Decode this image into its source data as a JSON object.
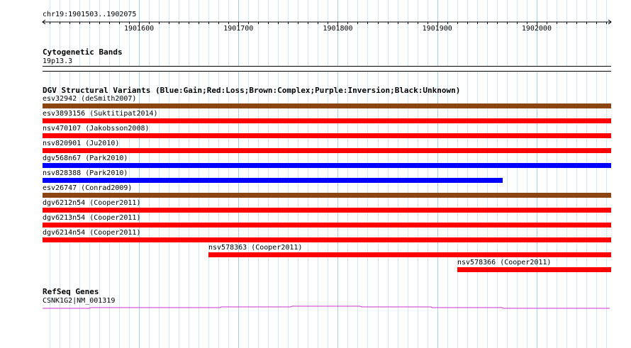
{
  "ruler": {
    "location": "chr19:1901503..1902075",
    "ticks": [
      "1901600",
      "1901700",
      "1901800",
      "1901900",
      "1902000"
    ]
  },
  "cytoband": {
    "title": "Cytogenetic Bands",
    "band": "19p13.3"
  },
  "dgv": {
    "title": "DGV Structural Variants (Blue:Gain;Red:Loss;Brown:Complex;Purple:Inversion;Black:Unknown)",
    "colors": {
      "gain": "#0000ff",
      "loss": "#ff0000",
      "complex": "#8b4513",
      "inversion": "#800080",
      "unknown": "#000000"
    },
    "variants": [
      {
        "label": "esv32942 (deSmith2007)",
        "type": "complex",
        "start": 1901503,
        "end": 1902075
      },
      {
        "label": "esv3893156 (Suktitipat2014)",
        "type": "loss",
        "start": 1901503,
        "end": 1902075
      },
      {
        "label": "nsv470107 (Jakobsson2008)",
        "type": "loss",
        "start": 1901503,
        "end": 1902075
      },
      {
        "label": "nsv820901 (Ju2010)",
        "type": "loss",
        "start": 1901503,
        "end": 1902075
      },
      {
        "label": "dgv568n67 (Park2010)",
        "type": "gain",
        "start": 1901503,
        "end": 1902075
      },
      {
        "label": "nsv828388 (Park2010)",
        "type": "gain",
        "start": 1901503,
        "end": 1901966
      },
      {
        "label": "esv26747 (Conrad2009)",
        "type": "complex",
        "start": 1901503,
        "end": 1902075
      },
      {
        "label": "dgv6212n54 (Cooper2011)",
        "type": "loss",
        "start": 1901503,
        "end": 1902075
      },
      {
        "label": "dgv6213n54 (Cooper2011)",
        "type": "loss",
        "start": 1901503,
        "end": 1902075
      },
      {
        "label": "dgv6214n54 (Cooper2011)",
        "type": "loss",
        "start": 1901503,
        "end": 1902075
      },
      {
        "label": "nsv578363 (Cooper2011)",
        "type": "loss",
        "start": 1901670,
        "end": 1902075
      },
      {
        "label": "nsv578366 (Cooper2011)",
        "type": "loss",
        "start": 1901920,
        "end": 1902075
      }
    ]
  },
  "refseq": {
    "title": "RefSeq Genes",
    "gene": "CSNK1G2|NM_001319",
    "color": "#cc33cc"
  }
}
